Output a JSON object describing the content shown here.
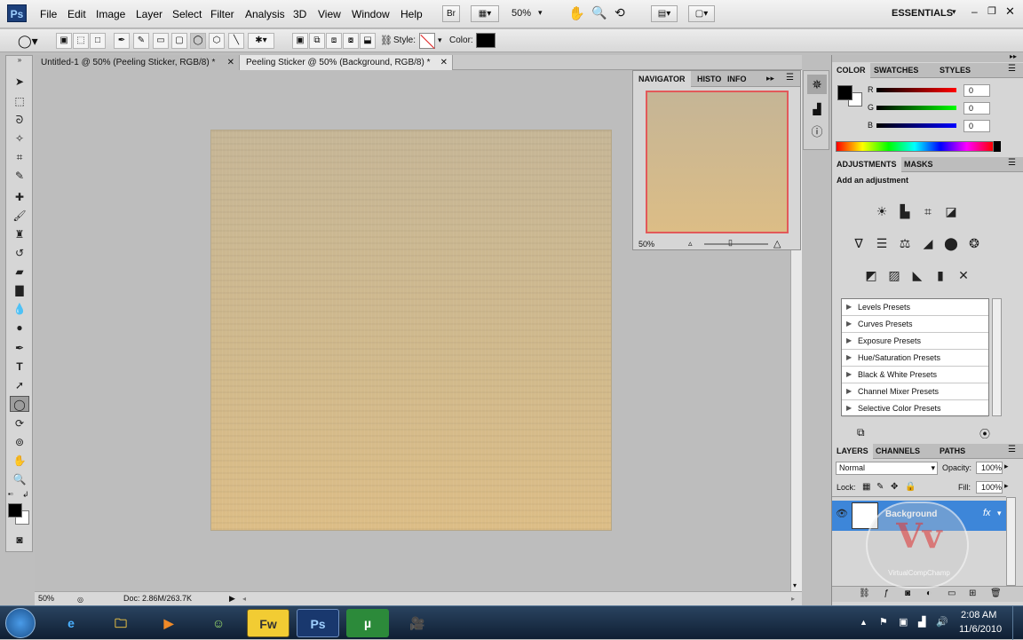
{
  "app": {
    "logo": "Ps",
    "workspace": "ESSENTIALS"
  },
  "menu": [
    "File",
    "Edit",
    "Image",
    "Layer",
    "Select",
    "Filter",
    "Analysis",
    "3D",
    "View",
    "Window",
    "Help"
  ],
  "appbar": {
    "bridge": "Br",
    "zoom": "50%"
  },
  "options": {
    "style_label": "Style:",
    "color_label": "Color:",
    "color": "#000000"
  },
  "tabs": [
    {
      "label": "Untitled-1 @ 50% (Peeling Sticker, RGB/8) *",
      "active": false
    },
    {
      "label": "Peeling Sticker @ 50% (Background, RGB/8) *",
      "active": true
    }
  ],
  "tools": [
    "move-tool",
    "marquee-tool",
    "lasso-tool",
    "quick-select-tool",
    "crop-tool",
    "eyedropper-tool",
    "healing-brush-tool",
    "brush-tool",
    "clone-stamp-tool",
    "history-brush-tool",
    "eraser-tool",
    "gradient-tool",
    "blur-tool",
    "dodge-tool",
    "pen-tool",
    "type-tool",
    "path-select-tool",
    "ellipse-tool",
    "rotate-3d-tool",
    "orbit-3d-tool",
    "hand-tool",
    "zoom-tool"
  ],
  "status": {
    "zoom": "50%",
    "doc": "Doc: 2.86M/263.7K"
  },
  "navigator": {
    "tabs": [
      "NAVIGATOR",
      "HISTO",
      "INFO"
    ],
    "zoom": "50%"
  },
  "color_panel": {
    "tabs": [
      "COLOR",
      "SWATCHES",
      "STYLES"
    ],
    "channels": [
      {
        "label": "R",
        "value": "0"
      },
      {
        "label": "G",
        "value": "0"
      },
      {
        "label": "B",
        "value": "0"
      }
    ]
  },
  "adjustments": {
    "tabs": [
      "ADJUSTMENTS",
      "MASKS"
    ],
    "title": "Add an adjustment",
    "presets": [
      "Levels Presets",
      "Curves Presets",
      "Exposure Presets",
      "Hue/Saturation Presets",
      "Black & White Presets",
      "Channel Mixer Presets",
      "Selective Color Presets"
    ]
  },
  "layers": {
    "tabs": [
      "LAYERS",
      "CHANNELS",
      "PATHS"
    ],
    "blend": "Normal",
    "opacity_label": "Opacity:",
    "opacity": "100%",
    "lock_label": "Lock:",
    "fill_label": "Fill:",
    "fill": "100%",
    "layer_name": "Background",
    "fx": "fx"
  },
  "watermark": {
    "text": "VirtualCompChamp"
  },
  "taskbar": {
    "apps": [
      "Fw",
      "Ps",
      "µ"
    ],
    "time": "2:08 AM",
    "date": "11/6/2010"
  }
}
